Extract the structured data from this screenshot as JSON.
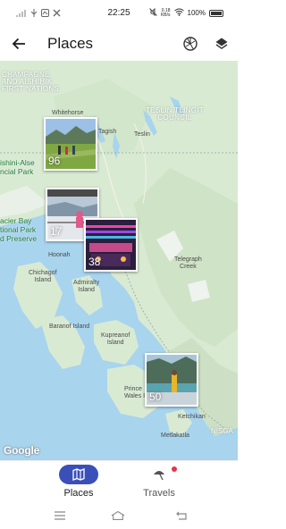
{
  "status_bar": {
    "time": "22:25",
    "network_speed": "0.18\nKB/s",
    "battery": "100%"
  },
  "app_bar": {
    "title": "Places"
  },
  "map": {
    "labels": {
      "champagne": "CHAMPAGNE\nAND AISHIHIK\nFIRST NATIONS",
      "teslin_tlingit": "TESLIN TLINGIT\nCOUNCIL",
      "whitehorse": "Whitehorse",
      "tagish": "Tagish",
      "teslin": "Teslin",
      "kluane": "ishini-Alse\nncial Park",
      "glacier_bay": "acier Bay\ntional Park\nd Preserve",
      "hoonah": "Hoonah",
      "chichagof": "Chichagof\nIsland",
      "admiralty": "Admiralty\nIsland",
      "baranof": "Baranof Island",
      "kupreanof": "Kupreanof\nIsland",
      "telegraph_creek": "Telegraph\nCreek",
      "prince_wales": "Prince\nWales I",
      "ketchikan": "Ketchikan",
      "metlakatla": "Metlakatla",
      "nisga": "NISGA"
    },
    "clusters": [
      {
        "count": "96",
        "theme": "hikers-meadow"
      },
      {
        "count": "17",
        "theme": "ship-deck"
      },
      {
        "count": "38",
        "theme": "neon-lounge"
      },
      {
        "count": "50",
        "theme": "fjord-deck"
      }
    ],
    "attribution": "Google"
  },
  "bottom_nav": {
    "items": [
      {
        "label": "Places",
        "icon": "map-icon",
        "active": true
      },
      {
        "label": "Travels",
        "icon": "travels-icon",
        "active": false,
        "badge": true
      }
    ]
  },
  "colors": {
    "accent": "#3b4fb8",
    "badge": "#e8334a",
    "water": "#a8d4ee",
    "land": "#d8ead2"
  }
}
